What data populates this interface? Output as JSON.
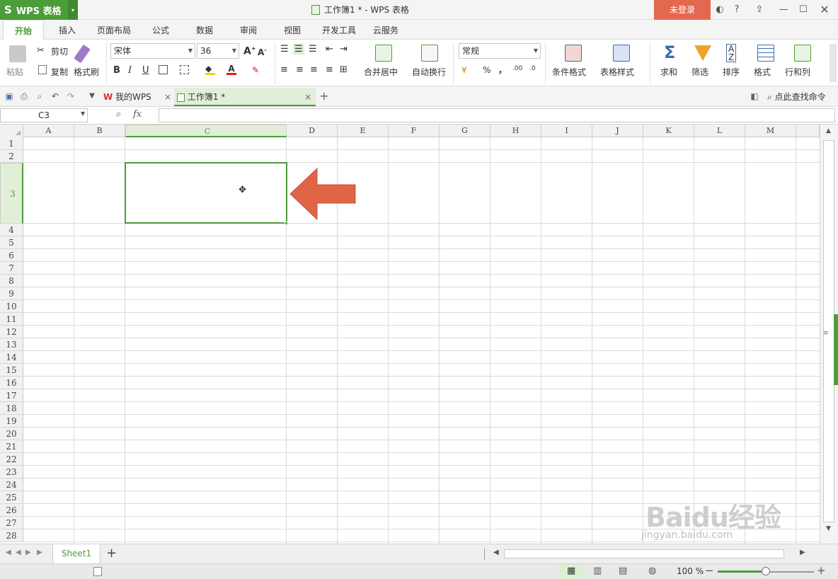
{
  "app": {
    "logo_letter": "S",
    "name": "WPS 表格",
    "menu_caret": "▾"
  },
  "window": {
    "title": "工作簿1 * - WPS 表格",
    "login_label": "未登录",
    "help": "?",
    "caret": "▾"
  },
  "tabs": [
    "开始",
    "插入",
    "页面布局",
    "公式",
    "数据",
    "审阅",
    "视图",
    "开发工具",
    "云服务"
  ],
  "ribbon": {
    "paste": "粘贴",
    "cut": "剪切",
    "copy": "复制",
    "format_painter": "格式刷",
    "font_name": "宋体",
    "font_size": "36",
    "bold": "B",
    "italic": "I",
    "underline": "U",
    "merge_center": "合并居中",
    "wrap_text": "自动换行",
    "number_format": "常规",
    "percent": "%",
    "comma": "，",
    "conditional_format": "条件格式",
    "table_style": "表格样式",
    "sum": "求和",
    "filter": "筛选",
    "sort": "排序",
    "format": "格式",
    "row_col": "行和列"
  },
  "doc_tabs": [
    {
      "label": "我的WPS"
    },
    {
      "label": "工作簿1 *"
    }
  ],
  "find_command": "点此查找命令",
  "formula_bar": {
    "cell_ref": "C3",
    "fx": "fx",
    "value": ""
  },
  "columns": [
    "A",
    "B",
    "C",
    "D",
    "E",
    "F",
    "G",
    "H",
    "I",
    "J",
    "K",
    "L",
    "M"
  ],
  "rows": [
    "1",
    "2",
    "3",
    "4",
    "5",
    "6",
    "7",
    "8",
    "9",
    "10",
    "11",
    "12",
    "13",
    "14",
    "15",
    "16",
    "17",
    "18",
    "19",
    "20",
    "21",
    "22",
    "23",
    "24",
    "25",
    "26",
    "27",
    "28"
  ],
  "selected_cell": "C3",
  "sheets": [
    "Sheet1"
  ],
  "status": {
    "zoom": "100 %",
    "zoom_level": 0.5
  },
  "watermark": {
    "brand": "Baidu经验",
    "url": "jingyan.baidu.com"
  },
  "colors": {
    "accent": "#4c9c3a",
    "login": "#e2684f",
    "arrow": "#e06446"
  }
}
